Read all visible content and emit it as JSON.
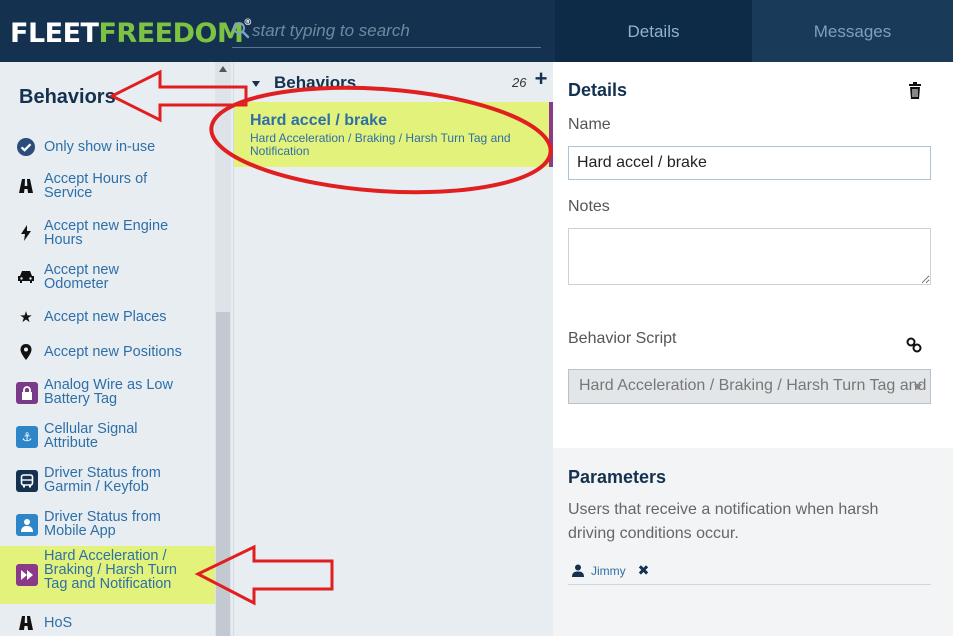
{
  "app": {
    "logo_part1": "FLEET",
    "logo_part2": "FREEDOM",
    "logo_mark": "®",
    "search_placeholder": "start typing to search",
    "tabs": {
      "details": "Details",
      "messages": "Messages"
    }
  },
  "sidebar": {
    "title": "Behaviors",
    "items": [
      {
        "label": "Only show in-use",
        "icon": "check-circle-icon",
        "icon_color": "#2a4d7a"
      },
      {
        "label": "Accept Hours of Service",
        "icon": "road-icon"
      },
      {
        "label": "Accept new Engine Hours",
        "icon": "bolt-icon"
      },
      {
        "label": "Accept new Odometer",
        "icon": "car-icon"
      },
      {
        "label": "Accept new Places",
        "icon": "star-icon"
      },
      {
        "label": "Accept new Positions",
        "icon": "map-pin-icon"
      },
      {
        "label": "Analog Wire as Low Battery Tag",
        "icon": "lock-icon",
        "icon_color": "#7a3a8a"
      },
      {
        "label": "Cellular Signal Attribute",
        "icon": "anchor-icon",
        "icon_color": "#2e86c8"
      },
      {
        "label": "Driver Status from Garmin / Keyfob",
        "icon": "bus-icon",
        "icon_color": "#14324f"
      },
      {
        "label": "Driver Status from Mobile App",
        "icon": "user-icon",
        "icon_color": "#2e86c8"
      },
      {
        "label": "Hard Acceleration / Braking / Harsh Turn Tag and Notification",
        "icon": "fast-forward-icon",
        "icon_color": "#8b3a8a",
        "selected": true
      },
      {
        "label": "HoS",
        "icon": "road-icon"
      }
    ]
  },
  "list": {
    "title": "Behaviors",
    "count": "26",
    "add_label": "+",
    "selected_item": {
      "title": "Hard accel / brake",
      "description": "Hard Acceleration / Braking / Harsh Turn Tag and Notification"
    }
  },
  "details": {
    "title": "Details",
    "name_label": "Name",
    "name_value": "Hard accel / brake",
    "notes_label": "Notes",
    "notes_value": "",
    "script_label": "Behavior Script",
    "script_value": "Hard Acceleration / Braking / Harsh Turn Tag and Notification",
    "parameters_title": "Parameters",
    "parameters_description": "Users that receive a notification when harsh driving conditions occur.",
    "user_chip": "Jimmy",
    "remove_symbol": "✖"
  },
  "colors": {
    "header_bg": "#14324f",
    "highlight": "#e3f27a",
    "accent": "#8b3a8a",
    "annotation_red": "#e02020"
  }
}
